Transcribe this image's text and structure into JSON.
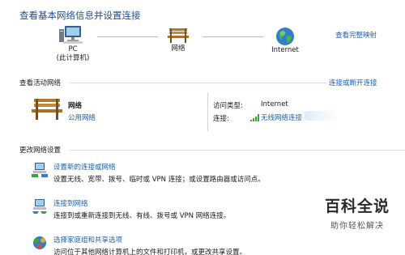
{
  "page": {
    "title": "查看基本网络信息并设置连接",
    "view_full_map": "查看完整映射"
  },
  "map": {
    "pc_label": "PC",
    "pc_sublabel": "(此计算机)",
    "network_label": "网络",
    "internet_label": "Internet"
  },
  "active_networks": {
    "heading": "查看活动网络",
    "connect_disconnect": "连接或断开连接",
    "network_name": "网络",
    "network_type": "公用网络",
    "access_type_label": "访问类型:",
    "access_type_value": "Internet",
    "connection_label": "连接:",
    "connection_value": "无线网络连接"
  },
  "change_settings": {
    "heading": "更改网络设置",
    "tasks": [
      {
        "title": "设置新的连接或网络",
        "description": "设置无线、宽带、拨号、临时或 VPN 连接；或设置路由器或访问点。"
      },
      {
        "title": "连接到网络",
        "description": "连接到或重新连接到无线、有线、拨号或 VPN 网络连接。"
      },
      {
        "title": "选择家庭组和共享选项",
        "description": "访问位于其他网络计算机上的文件和打印机，或更改共享设置。"
      }
    ]
  },
  "watermark": {
    "title": "百科全说",
    "subtitle": "助你轻松解决"
  },
  "colors": {
    "link": "#1f5fa8",
    "heading": "#1f4e8c",
    "signal": "#3aa536"
  }
}
